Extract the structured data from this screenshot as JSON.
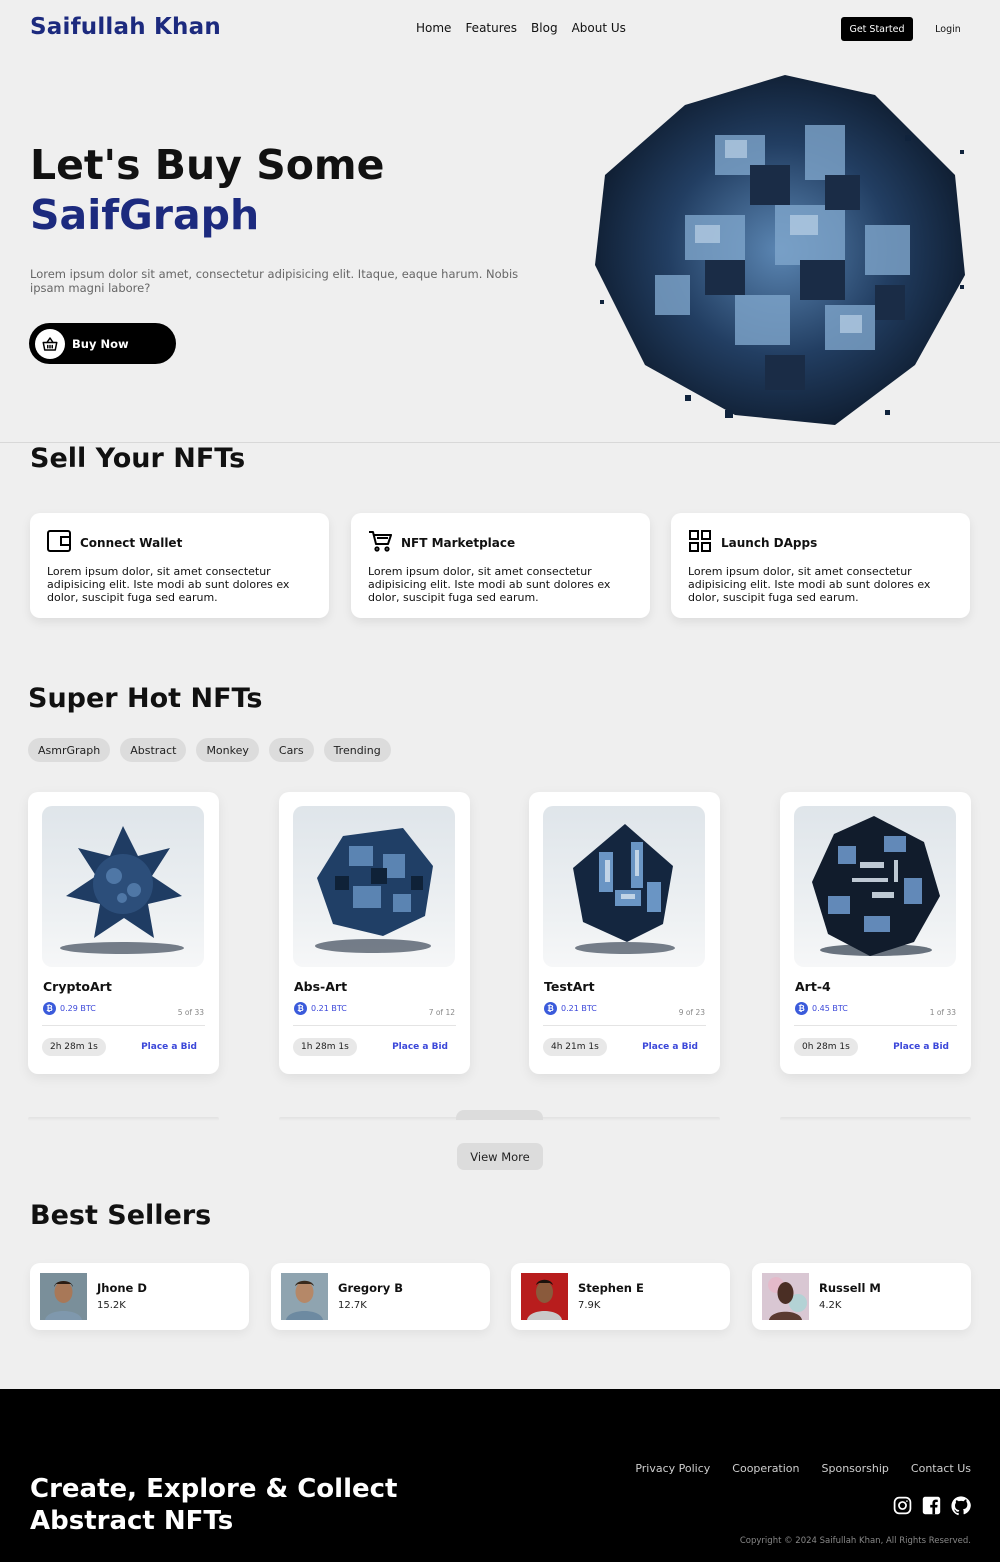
{
  "nav": {
    "brand": "Saifullah Khan",
    "menu": [
      "Home",
      "Features",
      "Blog",
      "About Us"
    ],
    "get_started": "Get Started",
    "login": "Login"
  },
  "hero": {
    "title_line1": "Let's Buy Some",
    "title_line2": "SaifGraph",
    "description": "Lorem ipsum dolor sit amet, consectetur adipisicing elit. Itaque, eaque harum. Nobis ipsam magni labore?",
    "buy_label": "Buy Now",
    "buy_icon": "basket-icon"
  },
  "sell": {
    "title": "Sell Your NFTs",
    "cards": [
      {
        "title": "Connect Wallet",
        "icon": "wallet-icon",
        "text": "Lorem ipsum dolor, sit amet consectetur adipisicing elit. Iste modi ab sunt dolores ex dolor, suscipit fuga sed earum."
      },
      {
        "title": "NFT Marketplace",
        "icon": "cart-icon",
        "text": "Lorem ipsum dolor, sit amet consectetur adipisicing elit. Iste modi ab sunt dolores ex dolor, suscipit fuga sed earum."
      },
      {
        "title": "Launch DApps",
        "icon": "grid-icon",
        "text": "Lorem ipsum dolor, sit amet consectetur adipisicing elit. Iste modi ab sunt dolores ex dolor, suscipit fuga sed earum."
      }
    ]
  },
  "hot": {
    "title": "Super Hot NFTs",
    "filters": [
      "AsmrGraph",
      "Abstract",
      "Monkey",
      "Cars",
      "Trending"
    ],
    "cards": [
      {
        "name": "CryptoArt",
        "price": "0.29 BTC",
        "count": "5 of 33",
        "time": "2h 28m 1s",
        "bid": "Place a Bid"
      },
      {
        "name": "Abs-Art",
        "price": "0.21 BTC",
        "count": "7 of 12",
        "time": "1h 28m 1s",
        "bid": "Place a Bid"
      },
      {
        "name": "TestArt",
        "price": "0.21 BTC",
        "count": "9 of 23",
        "time": "4h 21m 1s",
        "bid": "Place a Bid"
      },
      {
        "name": "Art-4",
        "price": "0.45 BTC",
        "count": "1 of 33",
        "time": "0h 28m 1s",
        "bid": "Place a Bid"
      }
    ],
    "view_more": "View More"
  },
  "sellers": {
    "title": "Best Sellers",
    "items": [
      {
        "name": "Jhone D",
        "value": "15.2K",
        "avatar_bg": "#7a8f9a"
      },
      {
        "name": "Gregory B",
        "value": "12.7K",
        "avatar_bg": "#8fa4b0"
      },
      {
        "name": "Stephen E",
        "value": "7.9K",
        "avatar_bg": "#b81d1d"
      },
      {
        "name": "Russell M",
        "value": "4.2K",
        "avatar_bg": "#d9c7d3"
      }
    ]
  },
  "footer": {
    "title_line1": "Create, Explore & Collect",
    "title_line2": "Abstract NFTs",
    "links": [
      "Privacy Policy",
      "Cooperation",
      "Sponsorship",
      "Contact Us"
    ],
    "social_icons": [
      "instagram-icon",
      "facebook-icon",
      "github-icon"
    ],
    "copyright": "Copyright © 2024 Saifullah Khan, All Rights Reserved."
  },
  "colors": {
    "brand": "#1c2a7e",
    "accent": "#3b47d9",
    "footer_bg": "#000000"
  }
}
